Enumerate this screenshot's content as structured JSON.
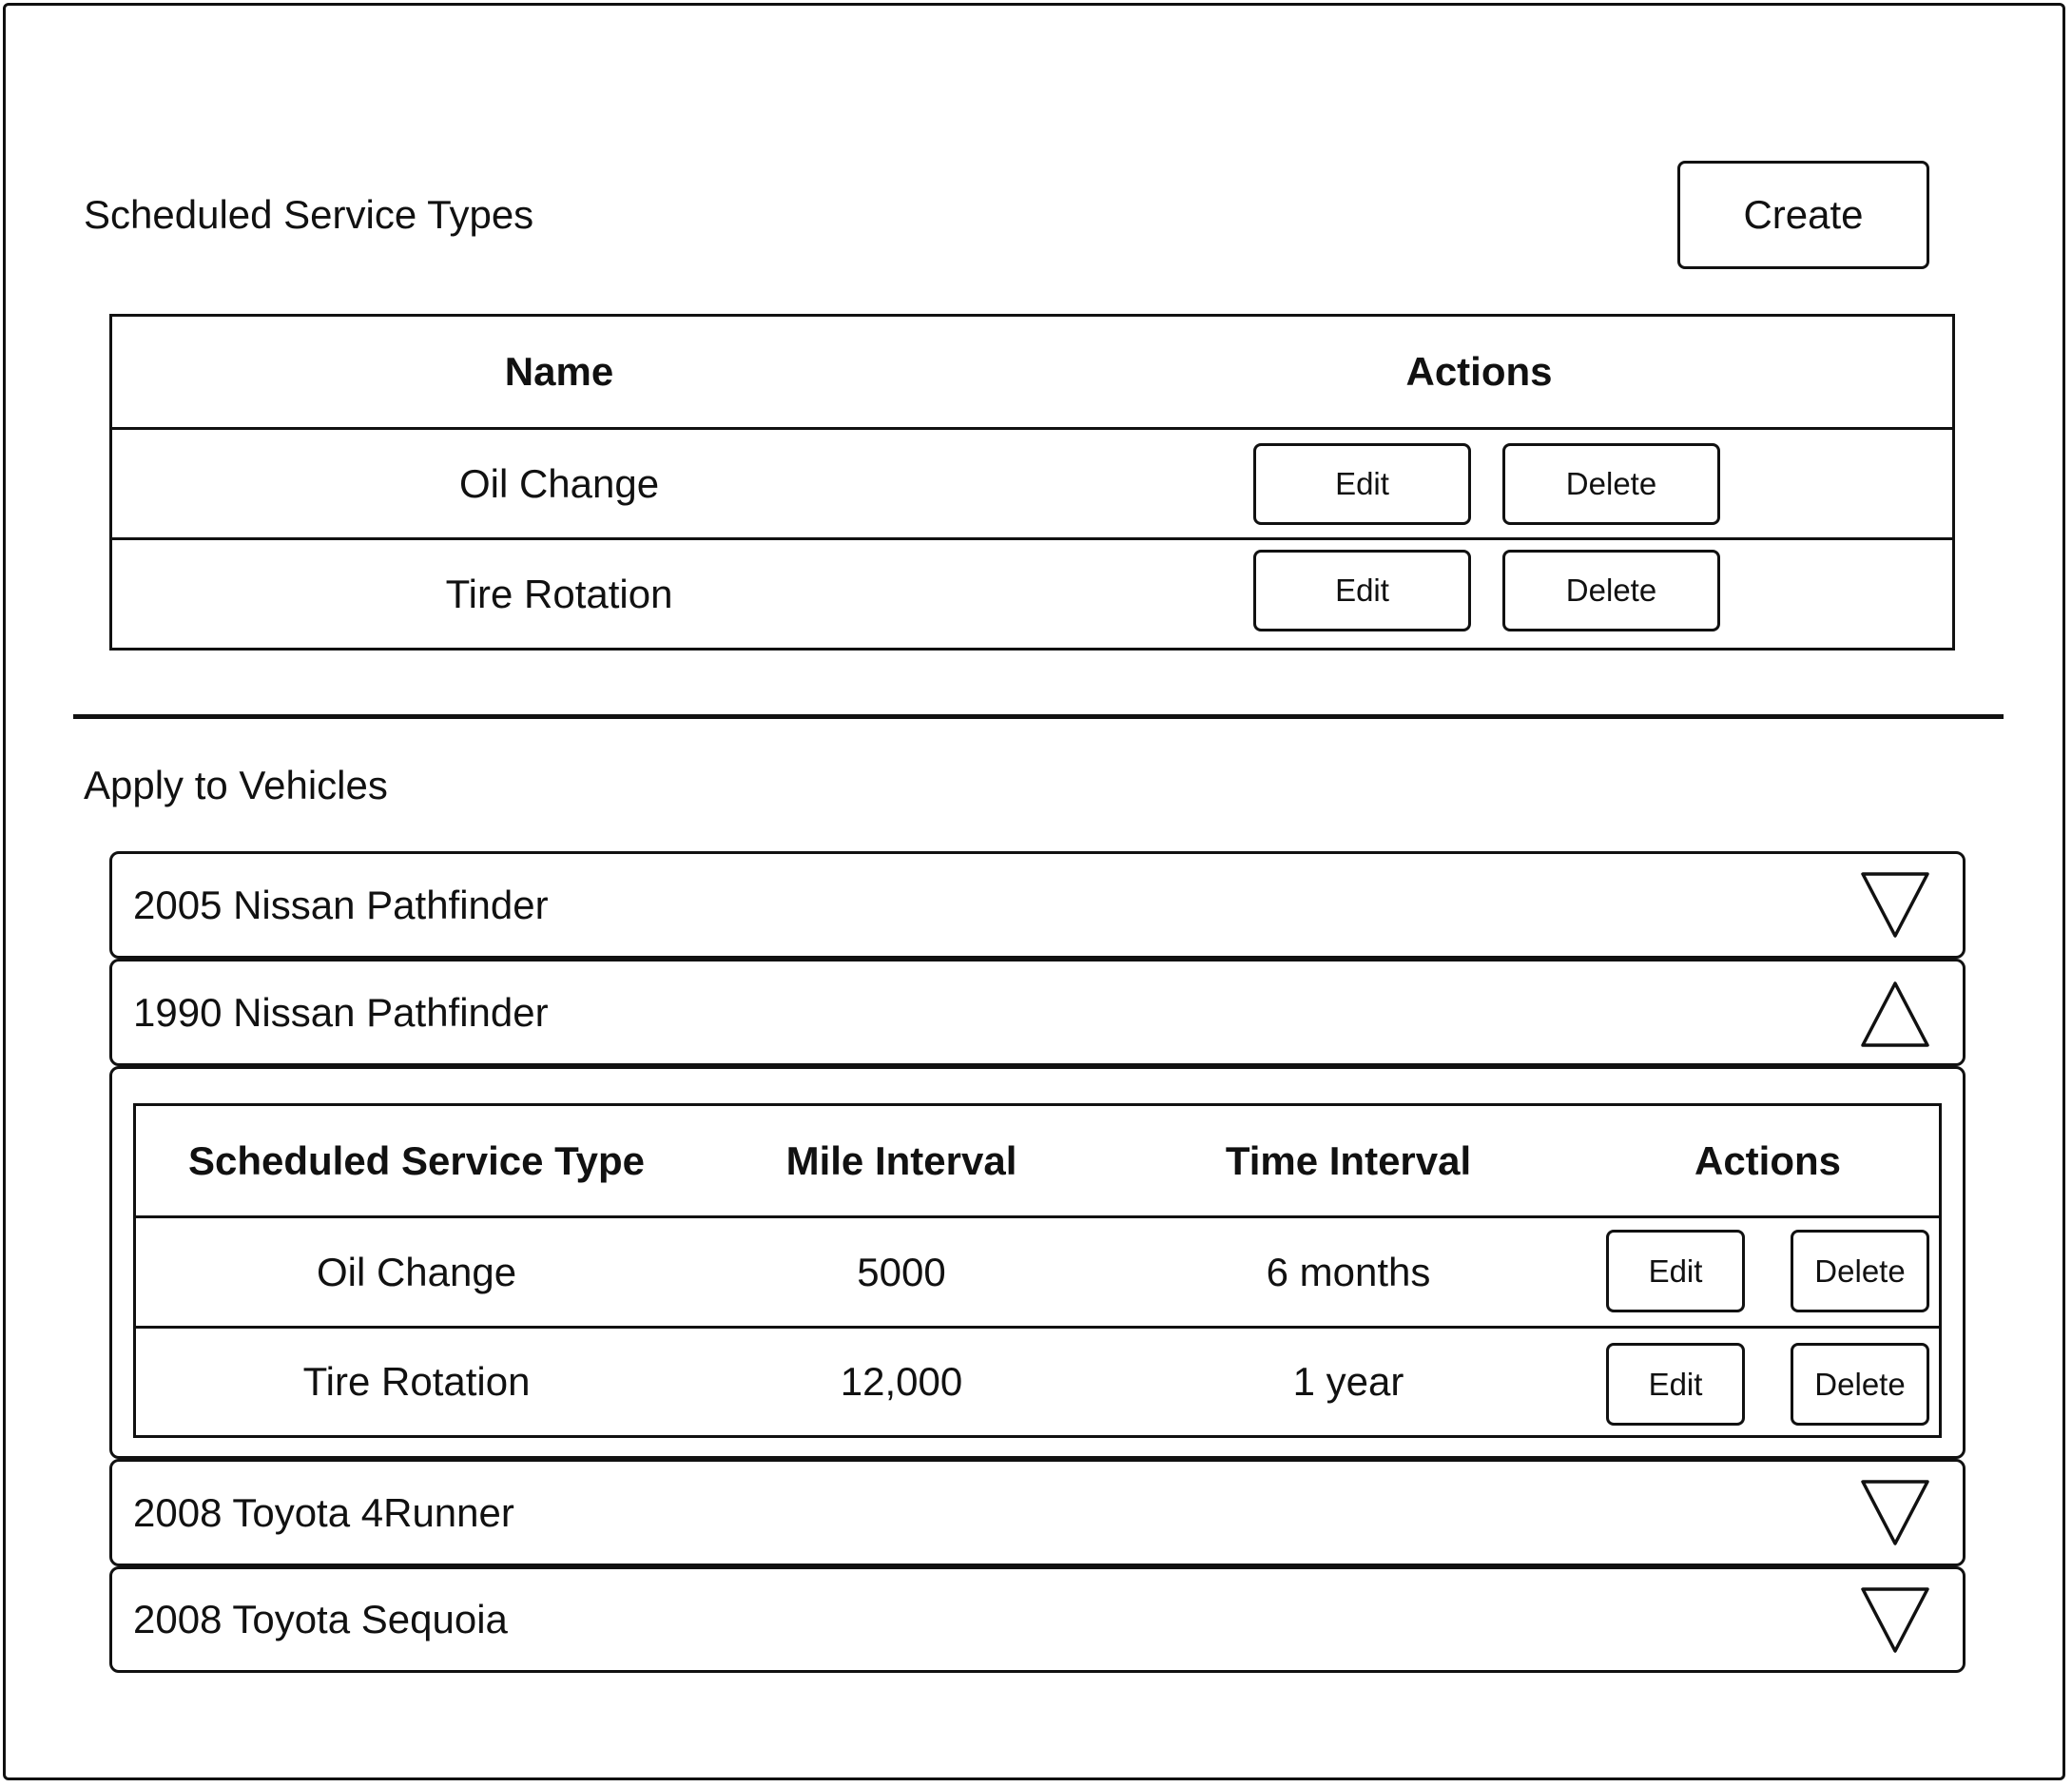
{
  "service_types": {
    "title": "Scheduled Service Types",
    "create_label": "Create",
    "columns": [
      "Name",
      "Actions"
    ],
    "rows": [
      {
        "name": "Oil Change",
        "edit_label": "Edit",
        "delete_label": "Delete"
      },
      {
        "name": "Tire Rotation",
        "edit_label": "Edit",
        "delete_label": "Delete"
      }
    ]
  },
  "vehicles": {
    "title": "Apply to Vehicles",
    "items": [
      {
        "label": "2005 Nissan Pathfinder",
        "toggle_icon": "chevron-down-icon"
      },
      {
        "label": "1990 Nissan Pathfinder",
        "toggle_icon": "chevron-up-icon"
      },
      {
        "label": "2008 Toyota 4Runner",
        "toggle_icon": "chevron-down-icon"
      },
      {
        "label": "2008 Toyota Sequoia",
        "toggle_icon": "chevron-down-icon"
      }
    ],
    "expanded": {
      "columns": [
        "Scheduled Service Type",
        "Mile Interval",
        "Time Interval",
        "Actions"
      ],
      "rows": [
        {
          "type": "Oil Change",
          "miles": "5000",
          "time": "6 months",
          "edit_label": "Edit",
          "delete_label": "Delete"
        },
        {
          "type": "Tire Rotation",
          "miles": "12,000",
          "time": "1 year",
          "edit_label": "Edit",
          "delete_label": "Delete"
        }
      ]
    }
  }
}
